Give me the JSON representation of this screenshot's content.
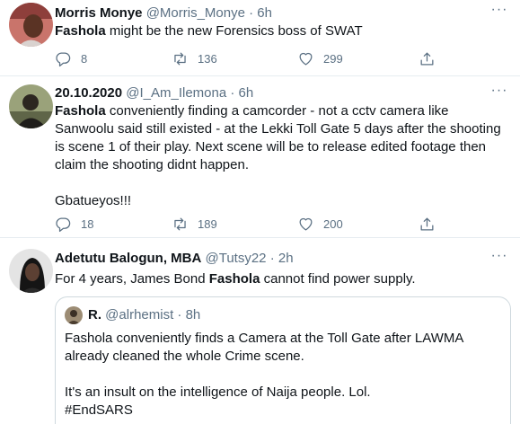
{
  "tweets": [
    {
      "name": "Morris Monye",
      "handle": "@Morris_Monye",
      "sep": "·",
      "time": "6h",
      "bold": "Fashola",
      "body": " might be the new Forensics boss of SWAT",
      "replies": "8",
      "retweets": "136",
      "likes": "299"
    },
    {
      "name": "20.10.2020",
      "handle": "@I_Am_Ilemona",
      "sep": "·",
      "time": "6h",
      "bold": "Fashola",
      "body": " conveniently finding a camcorder - not a cctv camera like Sanwoolu said still existed - at the Lekki Toll Gate 5 days after the shooting is scene 1 of their play. Next scene will be to release edited footage then claim the shooting didnt happen.\n\nGbatueyos!!!",
      "replies": "18",
      "retweets": "189",
      "likes": "200"
    },
    {
      "name": "Adetutu Balogun, MBA",
      "handle": "@Tutsy22",
      "sep": "·",
      "time": "2h",
      "pre": "For 4 years, James Bond ",
      "bold": "Fashola",
      "body": " cannot find power supply."
    }
  ],
  "quoted": {
    "name": "R.",
    "handle": "@alrhemist",
    "sep": "·",
    "time": "8h",
    "body": "Fashola conveniently finds a Camera at the Toll Gate after LAWMA already cleaned the whole Crime scene.\n\nIt's an insult on the intelligence of Naija people. Lol.\n#EndSARS"
  },
  "icons": {
    "more": "more-icon",
    "reply": "reply-icon",
    "retweet": "retweet-icon",
    "like": "like-icon",
    "share": "share-icon"
  },
  "colors": {
    "text": "#0f1419",
    "muted": "#5b7083",
    "border": "#e6ecf0"
  }
}
